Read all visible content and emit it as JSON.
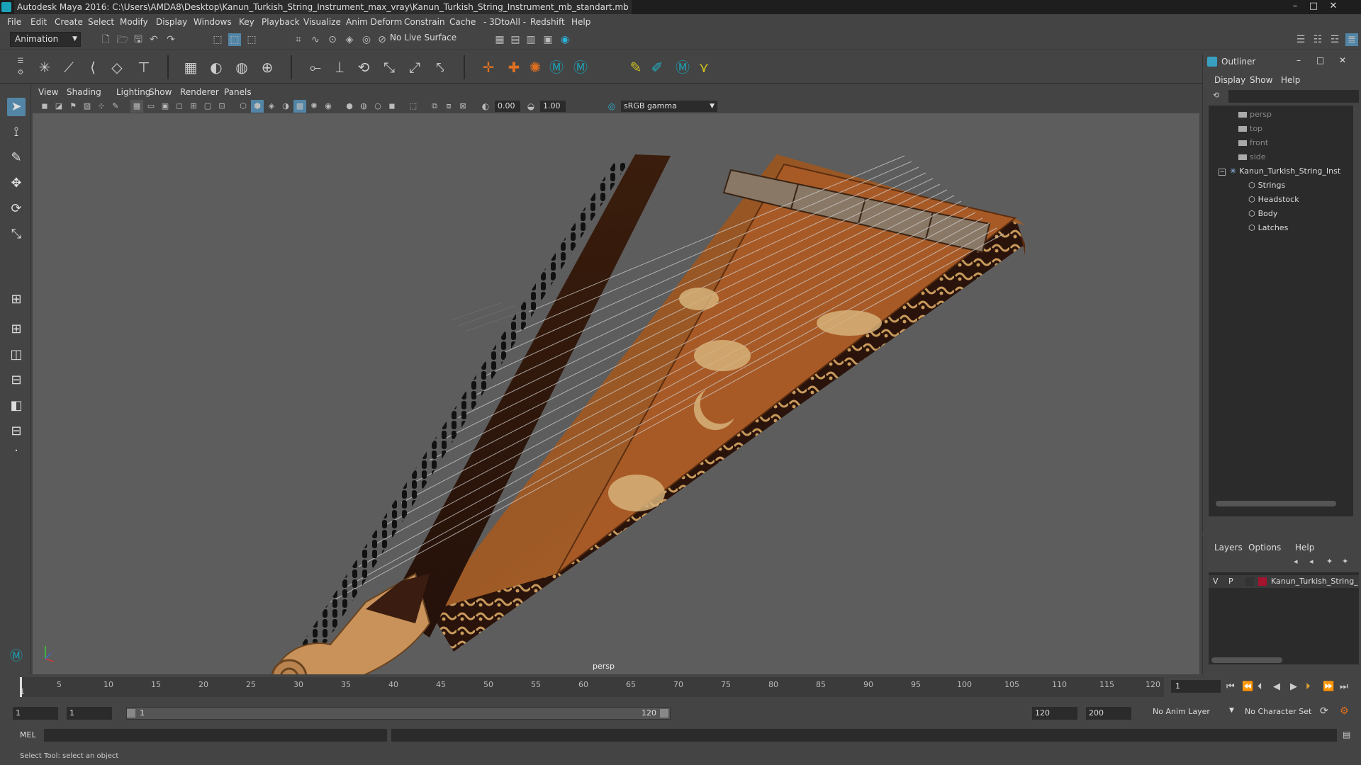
{
  "window": {
    "title": "Autodesk Maya 2016: C:\\Users\\AMDA8\\Desktop\\Kanun_Turkish_String_Instrument_max_vray\\Kanun_Turkish_String_Instrument_mb_standart.mb",
    "minimize": "–",
    "maximize": "□",
    "close": "✕"
  },
  "menubar": [
    "File",
    "Edit",
    "Create",
    "Select",
    "Modify",
    "Display",
    "Windows",
    "Key",
    "Playback",
    "Visualize",
    "Anim Deform",
    "Constrain",
    "Cache",
    "- 3DtoAll -",
    "Redshift",
    "Help"
  ],
  "status_line": {
    "mode": "Animation",
    "live_surface": "No Live Surface"
  },
  "viewport": {
    "menu": [
      "View",
      "Shading",
      "Lighting",
      "Show",
      "Renderer",
      "Panels"
    ],
    "exposure": "0.00",
    "gamma": "1.00",
    "color_space": "sRGB gamma",
    "camera_label": "persp"
  },
  "outliner": {
    "title": "Outliner",
    "menu": [
      "Display",
      "Show",
      "Help"
    ],
    "items": [
      {
        "label": "persp",
        "type": "camera"
      },
      {
        "label": "top",
        "type": "camera"
      },
      {
        "label": "front",
        "type": "camera"
      },
      {
        "label": "side",
        "type": "camera"
      },
      {
        "label": "Kanun_Turkish_String_Inst",
        "type": "group"
      },
      {
        "label": "Strings",
        "type": "mesh"
      },
      {
        "label": "Headstock",
        "type": "mesh"
      },
      {
        "label": "Body",
        "type": "mesh"
      },
      {
        "label": "Latches",
        "type": "mesh"
      }
    ]
  },
  "layers": {
    "menu": [
      "Layers",
      "Options",
      "Help"
    ],
    "row": {
      "v": "V",
      "p": "P",
      "name": "Kanun_Turkish_String_",
      "color": "#a3142e"
    }
  },
  "timeline": {
    "ticks": [
      "1",
      "5",
      "10",
      "15",
      "20",
      "25",
      "30",
      "35",
      "40",
      "45",
      "50",
      "55",
      "60",
      "65",
      "70",
      "75",
      "80",
      "85",
      "90",
      "95",
      "100",
      "105",
      "110",
      "115",
      "120"
    ],
    "current_frame": "1"
  },
  "range": {
    "start": "1",
    "playback_start": "1",
    "slider_start": "1",
    "slider_end": "120",
    "playback_end": "120",
    "end": "200",
    "anim_layer": "No Anim Layer",
    "character_set": "No Character Set"
  },
  "command_line": {
    "label": "MEL"
  },
  "help_line": "Select Tool: select an object",
  "colors": {
    "accent": "#5285a6",
    "maya_teal": "#1aa3b8",
    "layer_red": "#a3142e"
  }
}
